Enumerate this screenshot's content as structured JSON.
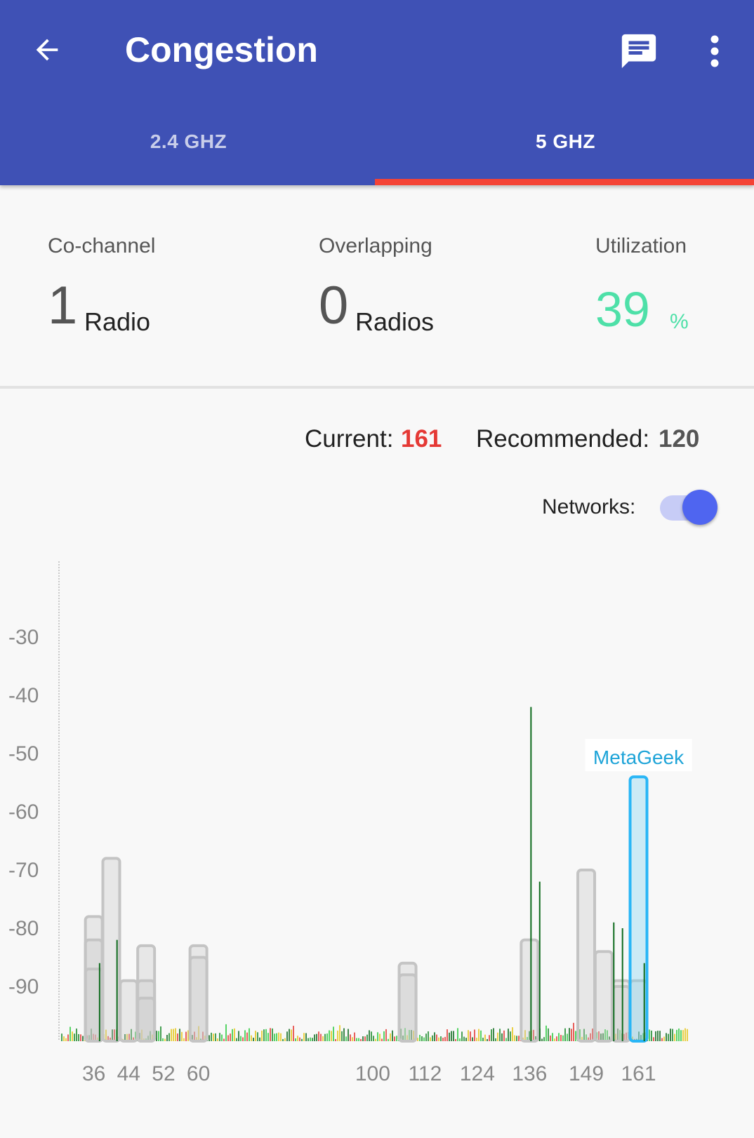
{
  "appbar": {
    "title": "Congestion",
    "back_icon": "arrow-left-icon",
    "chat_icon": "chat-message-icon",
    "more_icon": "more-vertical-icon",
    "background": "#3f51b5"
  },
  "tabs": [
    {
      "label": "2.4 GHZ",
      "selected": false
    },
    {
      "label": "5 GHZ",
      "selected": true
    }
  ],
  "stats": {
    "cochannel": {
      "label": "Co-channel",
      "value": "1",
      "unit": "Radio"
    },
    "overlapping": {
      "label": "Overlapping",
      "value": "0",
      "unit": "Radios"
    },
    "utilization": {
      "label": "Utilization",
      "value": "39",
      "unit": "%",
      "color": "#4ee0a8"
    }
  },
  "channels": {
    "current_label": "Current:",
    "current_value": "161",
    "current_color": "#e53935",
    "recommended_label": "Recommended:",
    "recommended_value": "120"
  },
  "networks_toggle": {
    "label": "Networks:",
    "on": true,
    "color": "#4f65f0"
  },
  "chart_data": {
    "type": "bar",
    "ylim": [
      -100,
      -20
    ],
    "y_ticks": [
      -30,
      -40,
      -50,
      -60,
      -70,
      -80,
      -90
    ],
    "x_ticks": [
      36,
      44,
      52,
      60,
      100,
      112,
      124,
      136,
      149,
      161
    ],
    "xlim": [
      28,
      173
    ],
    "networks": [
      {
        "channel": 36,
        "dbm": -78
      },
      {
        "channel": 36,
        "dbm": -82
      },
      {
        "channel": 36,
        "dbm": -87
      },
      {
        "channel": 40,
        "dbm": -68
      },
      {
        "channel": 44,
        "dbm": -89
      },
      {
        "channel": 48,
        "dbm": -83
      },
      {
        "channel": 48,
        "dbm": -89
      },
      {
        "channel": 48,
        "dbm": -92
      },
      {
        "channel": 60,
        "dbm": -83
      },
      {
        "channel": 60,
        "dbm": -85
      },
      {
        "channel": 108,
        "dbm": -86
      },
      {
        "channel": 108,
        "dbm": -88
      },
      {
        "channel": 136,
        "dbm": -82
      },
      {
        "channel": 149,
        "dbm": -70
      },
      {
        "channel": 153,
        "dbm": -84
      },
      {
        "channel": 157,
        "dbm": -89
      },
      {
        "channel": 157,
        "dbm": -90
      },
      {
        "channel": 161,
        "dbm": -89
      },
      {
        "channel": 161,
        "dbm": -54,
        "name": "MetaGeek",
        "highlight": true
      }
    ],
    "spikes": [
      {
        "channel": 37,
        "dbm": -86
      },
      {
        "channel": 41,
        "dbm": -82
      },
      {
        "channel": 136,
        "dbm": -42
      },
      {
        "channel": 138,
        "dbm": -72
      },
      {
        "channel": 155,
        "dbm": -79
      },
      {
        "channel": 157,
        "dbm": -80
      },
      {
        "channel": 162,
        "dbm": -86
      }
    ],
    "highlight_color": "#29b6f6",
    "label_color": "#1ea4d8"
  }
}
